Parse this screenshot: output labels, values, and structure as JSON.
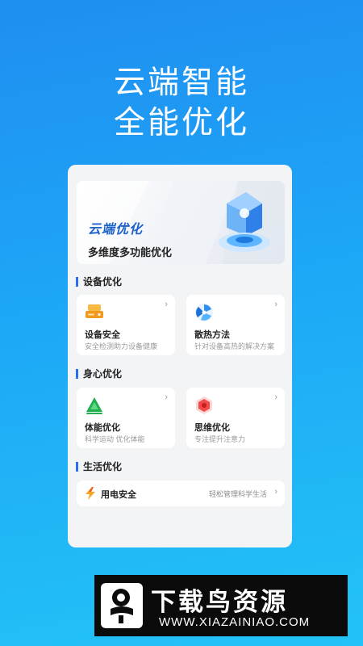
{
  "headline": {
    "line1": "云端智能",
    "line2": "全能优化"
  },
  "banner": {
    "title": "云端优化",
    "subtitle": "多维度多功能优化"
  },
  "sections": [
    {
      "title": "设备优化"
    },
    {
      "title": "身心优化"
    },
    {
      "title": "生活优化"
    }
  ],
  "tiles": {
    "device_safety": {
      "title": "设备安全",
      "desc": "安全检测助力设备健康",
      "icon": "drive-icon"
    },
    "cooling": {
      "title": "散热方法",
      "desc": "针对设备高热的解决方案",
      "icon": "fan-icon"
    },
    "fitness": {
      "title": "体能优化",
      "desc": "科学运动 优化体能",
      "icon": "triangle-up-icon"
    },
    "mind": {
      "title": "思维优化",
      "desc": "专注提升注意力",
      "icon": "hexagon-icon"
    }
  },
  "row": {
    "label": "用电安全",
    "right": "轻松管理科学生活",
    "icon": "lightning-icon"
  },
  "chevron": "›",
  "footer": {
    "brand": "下载鸟资源",
    "url": "WWW.XIAZAINIAO.COM"
  },
  "colors": {
    "accent": "#2a6df4",
    "background_top": "#1f8ef1",
    "background_bottom": "#22c3f7"
  }
}
